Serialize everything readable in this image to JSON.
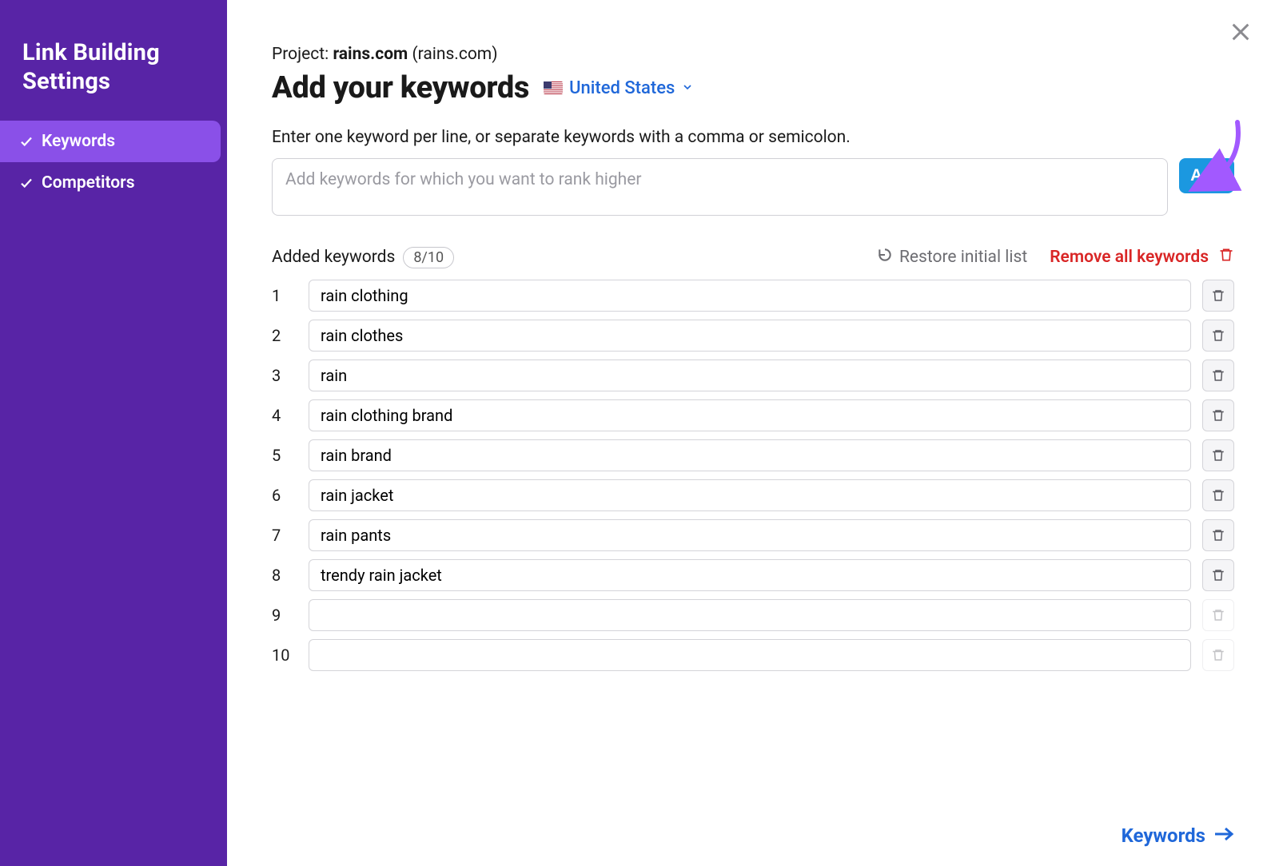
{
  "sidebar": {
    "title": "Link Building Settings",
    "items": [
      {
        "label": "Keywords",
        "active": true
      },
      {
        "label": "Competitors",
        "active": false
      }
    ]
  },
  "header": {
    "project_label": "Project: ",
    "project_name": "rains.com",
    "project_domain": " (rains.com)",
    "title": "Add your keywords",
    "locale_label": "United States"
  },
  "add_section": {
    "instructions": "Enter one keyword per line, or separate keywords with a comma or semicolon.",
    "placeholder": "Add keywords for which you want to rank higher",
    "add_label": "Add"
  },
  "added": {
    "label": "Added keywords",
    "count_text": "8/10",
    "restore_label": "Restore initial list",
    "remove_all_label": "Remove all keywords",
    "max_rows": 10,
    "keywords": [
      "rain clothing",
      "rain clothes",
      "rain",
      "rain clothing brand",
      "rain brand",
      "rain jacket",
      "rain pants",
      "trendy rain jacket"
    ]
  },
  "footer": {
    "next_label": "Keywords"
  }
}
